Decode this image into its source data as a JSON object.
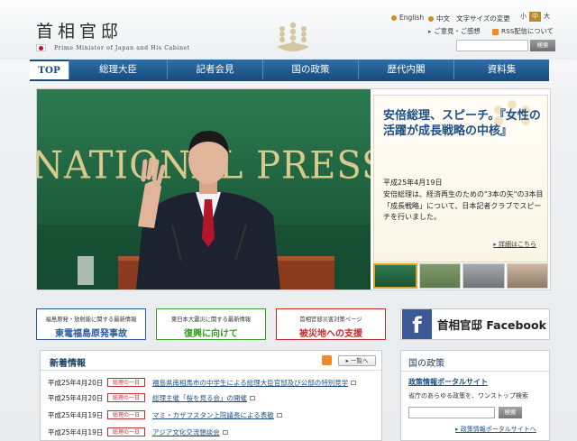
{
  "header": {
    "title_jp": "首相官邸",
    "title_en": "Prime Minister of Japan and His Cabinet",
    "lang_english": "English",
    "lang_chinese": "中文",
    "font_size_label": "文字サイズの変更",
    "font_sizes": [
      "小",
      "中",
      "大"
    ],
    "feedback_link": "ご意見・ご感想",
    "rss_link": "RSS配信について",
    "search_button": "検索",
    "search_placeholder": ""
  },
  "nav": {
    "items": [
      "TOP",
      "総理大臣",
      "記者会見",
      "国の政策",
      "歴代内閣",
      "資料集"
    ]
  },
  "hero": {
    "banner_text": "NATIONAL PRESS",
    "title": "安倍総理、スピーチ。『女性の活躍が成長戦略の中核』",
    "date": "平成25年4月19日",
    "description": "安倍総理は、経済再生のための\"3本の矢\"の3本目「成長戦略」について、日本記者クラブでスピーチを行いました。",
    "more_link": "詳細はこちら"
  },
  "banners": [
    {
      "small": "福島原発・放射能に関する最新情報",
      "big": "東電福島原発事故",
      "color": "#2a5a9a"
    },
    {
      "small": "東日本大震災に関する最新情報",
      "big": "復興に向けて",
      "color": "#3c9a2e"
    },
    {
      "small": "首相官邸災害対策ページ",
      "big": "被災地への支援",
      "color": "#c42a2a"
    }
  ],
  "facebook": {
    "label": "首相官邸 Facebook",
    "icon": "f"
  },
  "news": {
    "title": "新着情報",
    "list_button": "一覧へ",
    "rows": [
      {
        "date": "平成25年4月20日",
        "badge": "総理の一日",
        "text": "福島県南相馬市の中学生による総理大臣官邸及び公邸の特別見学"
      },
      {
        "date": "平成25年4月20日",
        "badge": "総理の一日",
        "text": "総理主催「桜を見る会」の開催"
      },
      {
        "date": "平成25年4月19日",
        "badge": "総理の一日",
        "text": "マミ・カザフスタン上院議長による表敬"
      },
      {
        "date": "平成25年4月19日",
        "badge": "総理の一日",
        "text": "アジア文化交流懇談会"
      }
    ]
  },
  "policy": {
    "title": "国の政策",
    "portal": "政策情報ポータルサイト",
    "desc": "省庁のあらゆる政策を、ワンストップ検索",
    "search_button": "検索",
    "more": "政策情報ポータルサイトへ"
  }
}
